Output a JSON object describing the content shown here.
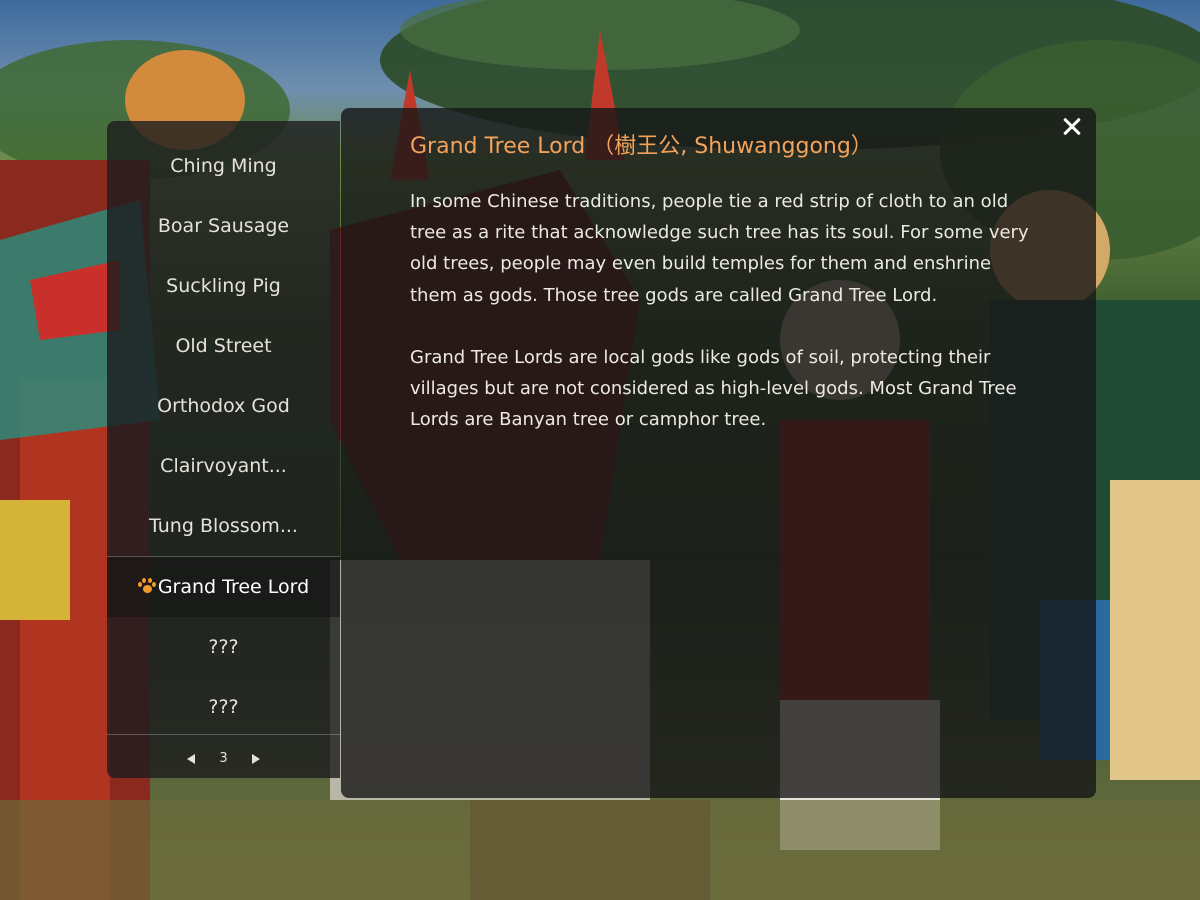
{
  "list": {
    "items": [
      {
        "label": "Ching Ming",
        "selected": false
      },
      {
        "label": "Boar Sausage",
        "selected": false
      },
      {
        "label": "Suckling Pig",
        "selected": false
      },
      {
        "label": "Old Street",
        "selected": false
      },
      {
        "label": "Orthodox God",
        "selected": false
      },
      {
        "label": "Clairvoyant...",
        "selected": false
      },
      {
        "label": "Tung Blossom...",
        "selected": false
      },
      {
        "label": "Grand Tree Lord",
        "selected": true
      },
      {
        "label": "???",
        "selected": false
      },
      {
        "label": "???",
        "selected": false
      }
    ],
    "selected_icon": "paw-icon",
    "pager": {
      "page": "3"
    }
  },
  "detail": {
    "title": "Grand Tree Lord （樹王公, Shuwanggong）",
    "paragraphs": [
      "In some Chinese traditions, people tie a red strip of cloth to an old tree as a rite that acknowledge such tree has its soul. For some very old trees, people may even build temples for them and enshrine them as gods. Those tree gods are called Grand Tree Lord.",
      "Grand Tree Lords are local gods like gods of soil, protecting their villages but are not considered as high-level gods. Most Grand Tree Lords are Banyan tree or camphor tree."
    ],
    "close_icon": "close-icon"
  },
  "colors": {
    "title_accent": "#f2a25a",
    "paw_accent": "#f39a2e",
    "panel_bg": "#1a1a1c"
  }
}
